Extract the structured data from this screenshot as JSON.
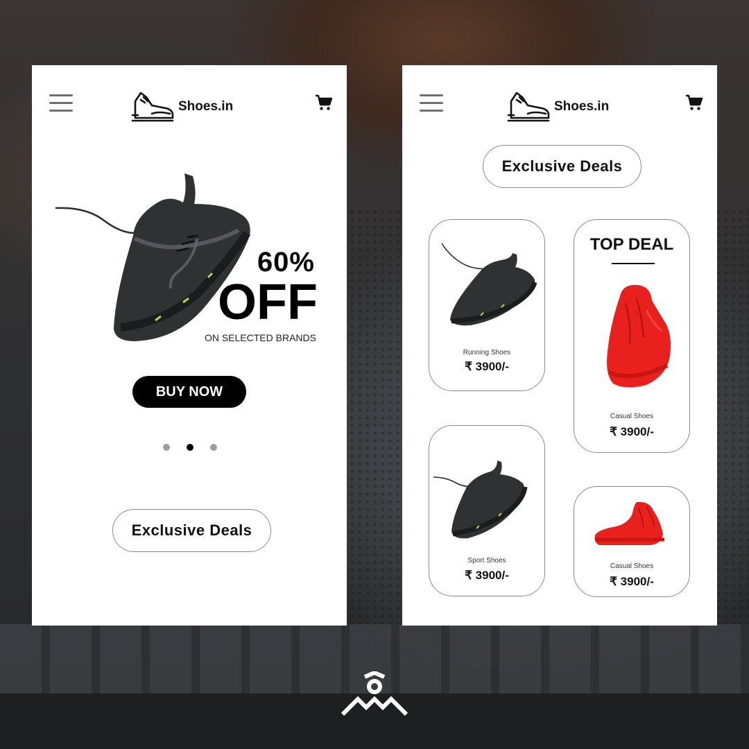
{
  "brand": {
    "name": "Shoes.in"
  },
  "colors": {
    "accent": "#000000",
    "card_border": "#8a8a8a",
    "shoe_red": "#e8201e",
    "shoe_dark": "#2f3133",
    "highlight": "#b9d64a"
  },
  "left_screen": {
    "promo": {
      "percent": "60%",
      "off": "OFF",
      "subtitle": "ON SELECTED BRANDS"
    },
    "buy_button": "BUY NOW",
    "carousel": {
      "count": 3,
      "active_index": 1
    },
    "deals_button": "Exclusive Deals"
  },
  "right_screen": {
    "deals_button": "Exclusive Deals",
    "cards": {
      "running": {
        "label": "Running Shoes",
        "price": "₹ 3900/-"
      },
      "top_deal": {
        "title": "TOP DEAL",
        "label": "Casual Shoes",
        "price": "₹ 3900/-"
      },
      "sport": {
        "label": "Sport Shoes",
        "price": "₹ 3900/-"
      },
      "casual": {
        "label": "Casual Shoes",
        "price": "₹ 3900/-"
      }
    }
  },
  "icons": [
    "menu-icon",
    "sneaker-logo-icon",
    "cart-icon",
    "shoe-image",
    "studio-brand-mark-icon"
  ]
}
